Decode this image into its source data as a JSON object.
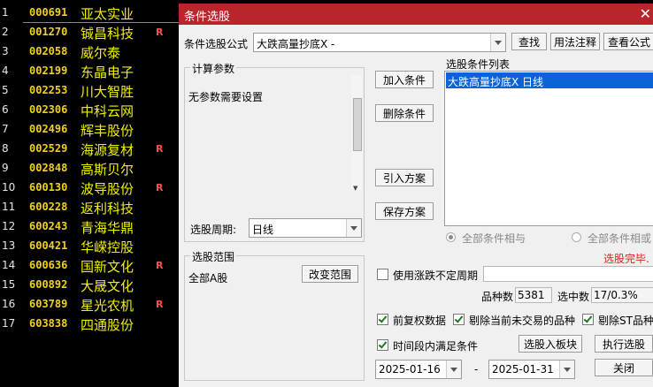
{
  "stocks": [
    {
      "idx": "1",
      "code": "000691",
      "name": "亚太实业",
      "flag": ""
    },
    {
      "idx": "2",
      "code": "001270",
      "name": "铖昌科技",
      "flag": "R"
    },
    {
      "idx": "3",
      "code": "002058",
      "name": "威尔泰",
      "flag": ""
    },
    {
      "idx": "4",
      "code": "002199",
      "name": "东晶电子",
      "flag": ""
    },
    {
      "idx": "5",
      "code": "002253",
      "name": "川大智胜",
      "flag": ""
    },
    {
      "idx": "6",
      "code": "002306",
      "name": "中科云网",
      "flag": ""
    },
    {
      "idx": "7",
      "code": "002496",
      "name": "辉丰股份",
      "flag": ""
    },
    {
      "idx": "8",
      "code": "002529",
      "name": "海源复材",
      "flag": "R"
    },
    {
      "idx": "9",
      "code": "002848",
      "name": "高斯贝尔",
      "flag": ""
    },
    {
      "idx": "10",
      "code": "600130",
      "name": "波导股份",
      "flag": "R"
    },
    {
      "idx": "11",
      "code": "600228",
      "name": "返利科技",
      "flag": ""
    },
    {
      "idx": "12",
      "code": "600243",
      "name": "青海华鼎",
      "flag": ""
    },
    {
      "idx": "13",
      "code": "600421",
      "name": "华嵘控股",
      "flag": ""
    },
    {
      "idx": "14",
      "code": "600636",
      "name": "国新文化",
      "flag": "R"
    },
    {
      "idx": "15",
      "code": "600892",
      "name": "大晟文化",
      "flag": ""
    },
    {
      "idx": "16",
      "code": "603789",
      "name": "星光农机",
      "flag": "R"
    },
    {
      "idx": "17",
      "code": "603838",
      "name": "四通股份",
      "flag": ""
    }
  ],
  "dialog": {
    "title": "条件选股",
    "formula_label": "条件选股公式",
    "formula_value": "大跌高量抄底X -",
    "find_btn": "查找",
    "usage_btn": "用法注释",
    "view_btn": "查看公式",
    "params_group": "计算参数",
    "params_text": "无参数需要设置",
    "period_label": "选股周期:",
    "period_value": "日线",
    "add_btn": "加入条件",
    "delete_btn": "删除条件",
    "import_btn": "引入方案",
    "save_btn": "保存方案",
    "cond_list_label": "选股条件列表",
    "cond_items": [
      "大跌高量抄底X  日线"
    ],
    "radio_and": "全部条件相与",
    "radio_or": "全部条件相或",
    "status": "选股完毕.",
    "range_group": "选股范围",
    "range_value": "全部A股",
    "change_range_btn": "改变范围",
    "uncertain_period": "使用涨跌不定周期",
    "count_label": "品种数",
    "count_value": "5381",
    "selected_label": "选中数",
    "selected_value": "17/0.3%",
    "chk_fq": "前复权数据",
    "chk_exclude": "剔除当前未交易的品种",
    "chk_st": "剔除ST品种",
    "chk_period": "时间段内满足条件",
    "to_block_btn": "选股入板块",
    "exec_btn": "执行选股",
    "date_from": "2025-01-16",
    "date_sep": "-",
    "date_to": "2025-01-31",
    "close_btn": "关闭",
    "colors": {
      "titlebar": "#b8262c",
      "selection": "#0a64d8",
      "status": "#e02020",
      "code": "#f0d020",
      "name": "#f0f000"
    }
  }
}
